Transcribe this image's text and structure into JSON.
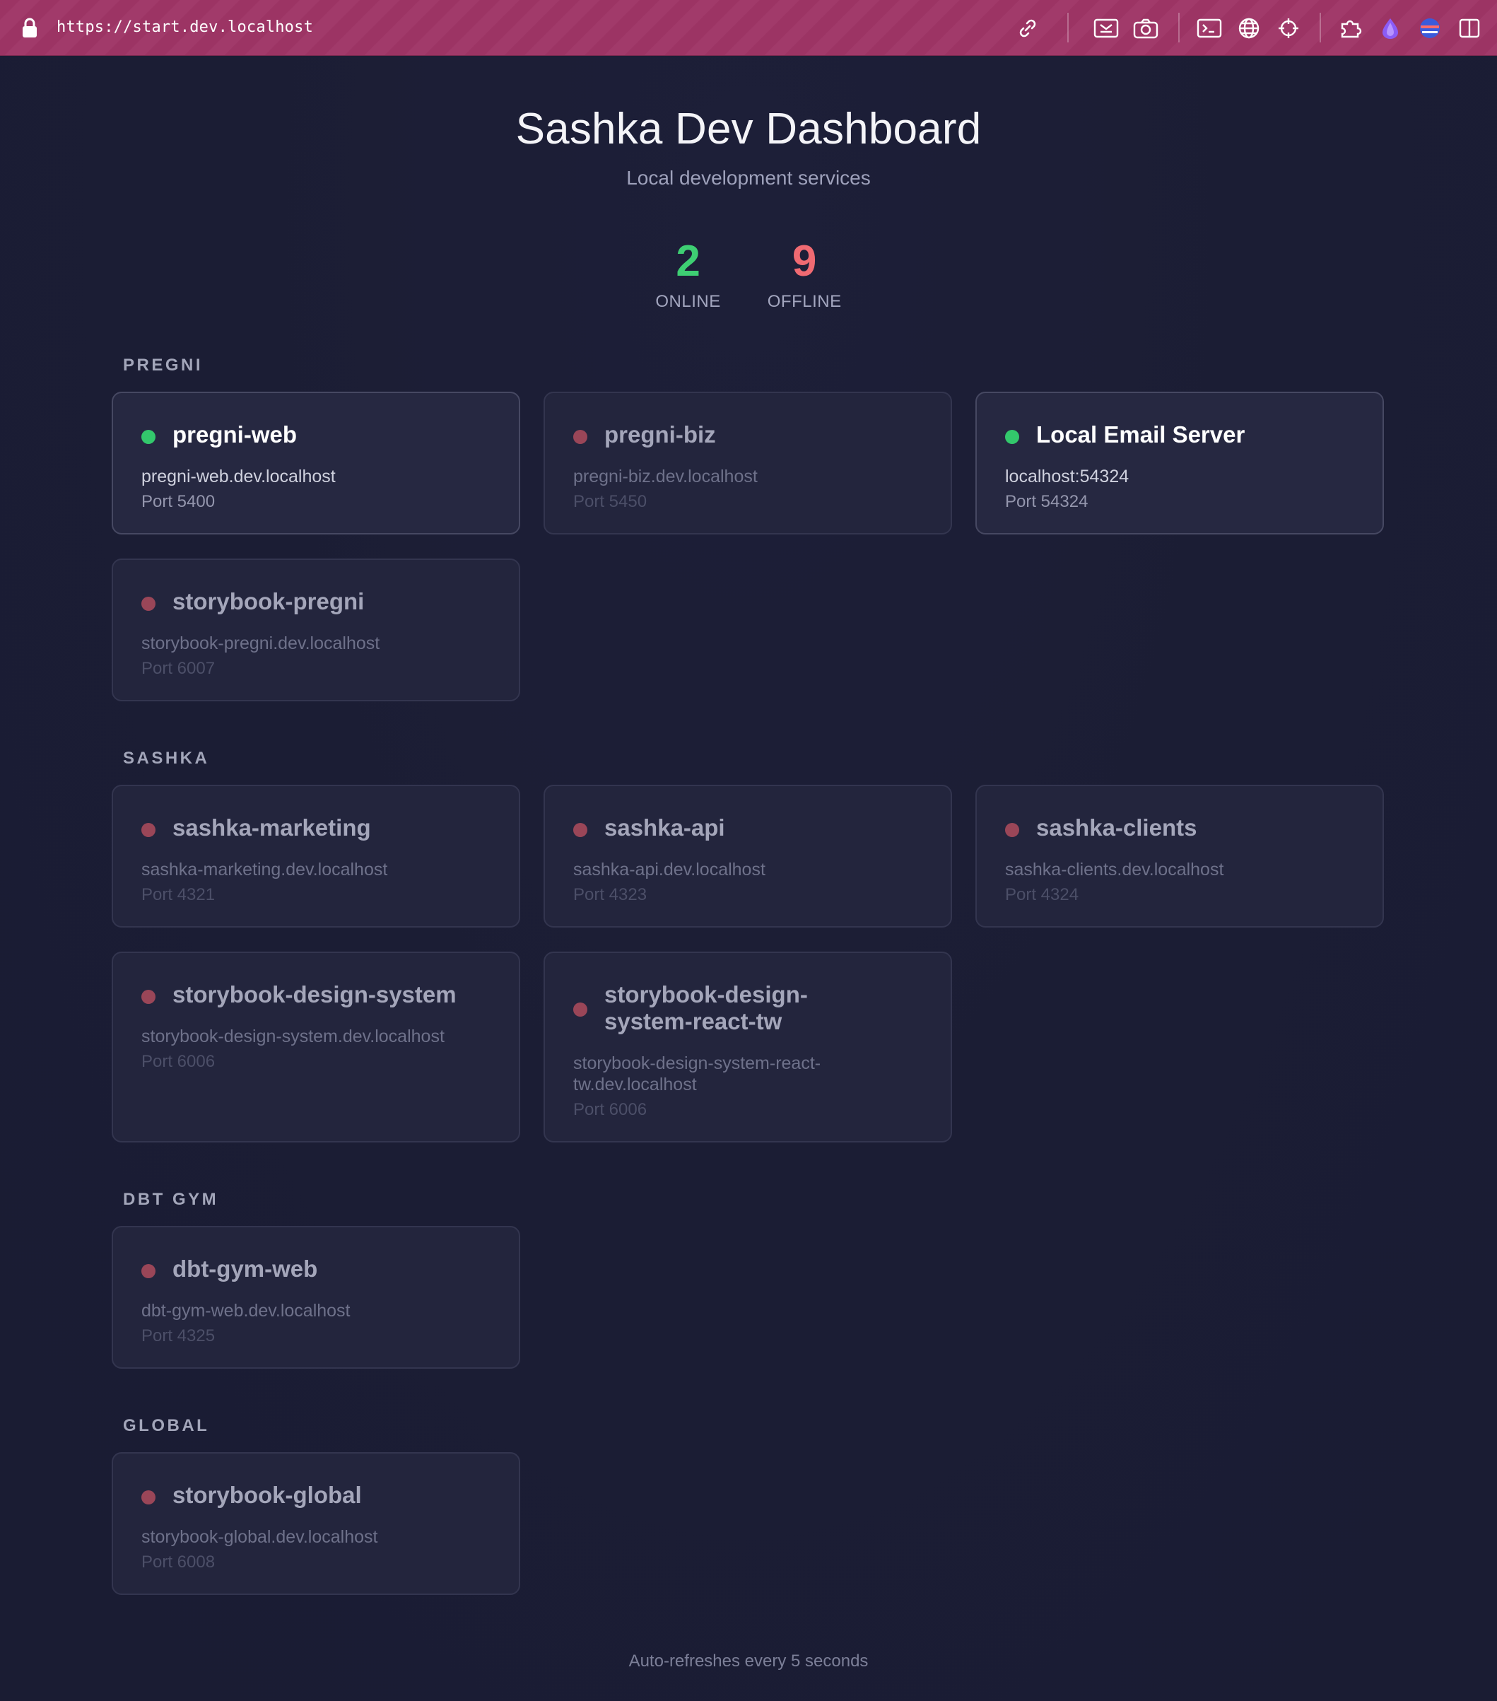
{
  "browser": {
    "url": "https://start.dev.localhost",
    "toolbar_icons": [
      "link-icon",
      "picture-in-picture-icon",
      "camera-icon",
      "terminal-icon",
      "globe-icon",
      "crosshair-icon",
      "puzzle-extension-icon",
      "purple-drop-extension-icon",
      "colored-sphere-extension-icon",
      "split-view-icon"
    ]
  },
  "header": {
    "title": "Sashka Dev Dashboard",
    "subtitle": "Local development services"
  },
  "stats": {
    "online_count": "2",
    "online_label": "ONLINE",
    "offline_count": "9",
    "offline_label": "OFFLINE"
  },
  "colors": {
    "online": "#3ecf73",
    "offline": "#f06a72",
    "background": "#1b1d34",
    "topbar": "#9c3464"
  },
  "groups": [
    {
      "title": "PREGNI",
      "services": [
        {
          "name": "pregni-web",
          "host": "pregni-web.dev.localhost",
          "port": "Port 5400",
          "status": "online"
        },
        {
          "name": "pregni-biz",
          "host": "pregni-biz.dev.localhost",
          "port": "Port 5450",
          "status": "offline"
        },
        {
          "name": "Local Email Server",
          "host": "localhost:54324",
          "port": "Port 54324",
          "status": "online"
        },
        {
          "name": "storybook-pregni",
          "host": "storybook-pregni.dev.localhost",
          "port": "Port 6007",
          "status": "offline"
        }
      ]
    },
    {
      "title": "SASHKA",
      "services": [
        {
          "name": "sashka-marketing",
          "host": "sashka-marketing.dev.localhost",
          "port": "Port 4321",
          "status": "offline"
        },
        {
          "name": "sashka-api",
          "host": "sashka-api.dev.localhost",
          "port": "Port 4323",
          "status": "offline"
        },
        {
          "name": "sashka-clients",
          "host": "sashka-clients.dev.localhost",
          "port": "Port 4324",
          "status": "offline"
        },
        {
          "name": "storybook-design-system",
          "host": "storybook-design-system.dev.localhost",
          "port": "Port 6006",
          "status": "offline"
        },
        {
          "name": "storybook-design-system-react-tw",
          "host": "storybook-design-system-react-tw.dev.localhost",
          "port": "Port 6006",
          "status": "offline"
        }
      ]
    },
    {
      "title": "DBT GYM",
      "services": [
        {
          "name": "dbt-gym-web",
          "host": "dbt-gym-web.dev.localhost",
          "port": "Port 4325",
          "status": "offline"
        }
      ]
    },
    {
      "title": "GLOBAL",
      "services": [
        {
          "name": "storybook-global",
          "host": "storybook-global.dev.localhost",
          "port": "Port 6008",
          "status": "offline"
        }
      ]
    }
  ],
  "footer": {
    "text": "Auto-refreshes every 5 seconds"
  }
}
